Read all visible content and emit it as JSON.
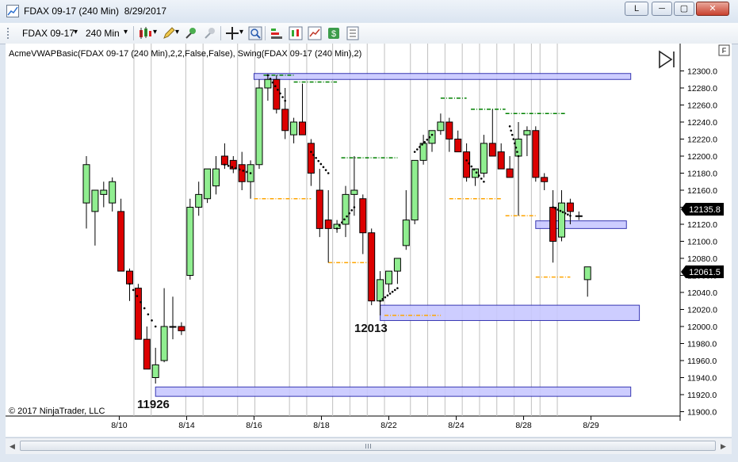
{
  "window": {
    "title": "FDAX 09-17 (240 Min)  8/29/2017",
    "btn_l": "L",
    "btn_min": "─",
    "btn_max": "▢",
    "btn_close": "✕"
  },
  "toolbar": {
    "instrument": "FDAX 09-17",
    "interval": "240 Min",
    "dropdown_glyph": "▾"
  },
  "chart": {
    "indicator_label": "AcmeVWAPBasic(FDAX 09-17 (240 Min),2,2,False,False), Swing(FDAX 09-17 (240 Min),2)",
    "copyright": "© 2017 NinjaTrader, LLC",
    "f_box": "F",
    "current_price_label": "12135.8",
    "secondary_price_label": "12061.5",
    "annotations": [
      "11926",
      "12013"
    ],
    "colors": {
      "up": "#90ee90",
      "down": "#dc0000",
      "zone": "#c8c8ff",
      "zone_border": "#2222aa",
      "swing_high": "#008000",
      "swing_low": "#ffa500"
    }
  },
  "chart_data": {
    "type": "candlestick",
    "instrument": "FDAX 09-17",
    "interval": "240 Min",
    "ylim": [
      11900,
      12310
    ],
    "y_ticks": [
      12300.0,
      12280.0,
      12260.0,
      12240.0,
      12220.0,
      12200.0,
      12180.0,
      12160.0,
      12140.0,
      12120.0,
      12100.0,
      12080.0,
      12060.0,
      12040.0,
      12020.0,
      12000.0,
      11980.0,
      11960.0,
      11940.0,
      11920.0,
      11900.0
    ],
    "x_tick_labels": [
      "8/10",
      "8/14",
      "8/16",
      "8/18",
      "8/22",
      "8/24",
      "8/28",
      "8/29"
    ],
    "x_tick_positions": [
      3.8,
      11.6,
      19.4,
      27.2,
      35.0,
      42.8,
      50.6,
      58.4
    ],
    "day_separators": [
      5.5,
      7.5,
      11.5,
      13.5,
      17.5,
      19.5,
      23.5,
      25.5,
      28.5,
      30.5,
      32.5,
      34.5,
      37.5,
      39.5,
      41.5,
      43.5,
      45.5,
      47.5,
      49.5,
      51.5,
      52.5,
      54.5
    ],
    "candles": [
      {
        "o": 12145,
        "h": 12200,
        "l": 12115,
        "c": 12190
      },
      {
        "o": 12135,
        "h": 12160,
        "l": 12095,
        "c": 12160
      },
      {
        "o": 12155,
        "h": 12170,
        "l": 12140,
        "c": 12160
      },
      {
        "o": 12145,
        "h": 12175,
        "l": 12135,
        "c": 12170
      },
      {
        "o": 12135,
        "h": 12150,
        "l": 12065,
        "c": 12065
      },
      {
        "o": 12065,
        "h": 12068,
        "l": 12030,
        "c": 12050
      },
      {
        "o": 12045,
        "h": 12050,
        "l": 11990,
        "c": 11985
      },
      {
        "o": 11985,
        "h": 12000,
        "l": 11960,
        "c": 11950
      },
      {
        "o": 11940,
        "h": 11975,
        "l": 11933,
        "c": 11955
      },
      {
        "o": 11960,
        "h": 12045,
        "l": 11958,
        "c": 12000
      },
      {
        "o": 12000,
        "h": 12035,
        "l": 11985,
        "c": 12000
      },
      {
        "o": 12000,
        "h": 12005,
        "l": 11990,
        "c": 11995
      },
      {
        "o": 12060,
        "h": 12150,
        "l": 12055,
        "c": 12140
      },
      {
        "o": 12140,
        "h": 12170,
        "l": 12130,
        "c": 12155
      },
      {
        "o": 12150,
        "h": 12185,
        "l": 12145,
        "c": 12185
      },
      {
        "o": 12165,
        "h": 12200,
        "l": 12155,
        "c": 12185
      },
      {
        "o": 12200,
        "h": 12215,
        "l": 12185,
        "c": 12190
      },
      {
        "o": 12195,
        "h": 12200,
        "l": 12180,
        "c": 12185
      },
      {
        "o": 12190,
        "h": 12205,
        "l": 12160,
        "c": 12170
      },
      {
        "o": 12170,
        "h": 12195,
        "l": 12150,
        "c": 12190
      },
      {
        "o": 12190,
        "h": 12290,
        "l": 12185,
        "c": 12280
      },
      {
        "o": 12280,
        "h": 12295,
        "l": 12265,
        "c": 12290
      },
      {
        "o": 12290,
        "h": 12295,
        "l": 12250,
        "c": 12255
      },
      {
        "o": 12255,
        "h": 12280,
        "l": 12220,
        "c": 12230
      },
      {
        "o": 12225,
        "h": 12245,
        "l": 12215,
        "c": 12240
      },
      {
        "o": 12240,
        "h": 12285,
        "l": 12225,
        "c": 12225
      },
      {
        "o": 12215,
        "h": 12220,
        "l": 12165,
        "c": 12180
      },
      {
        "o": 12160,
        "h": 12185,
        "l": 12105,
        "c": 12115
      },
      {
        "o": 12125,
        "h": 12160,
        "l": 12075,
        "c": 12115
      },
      {
        "o": 12115,
        "h": 12125,
        "l": 12110,
        "c": 12120
      },
      {
        "o": 12120,
        "h": 12165,
        "l": 12105,
        "c": 12155
      },
      {
        "o": 12155,
        "h": 12200,
        "l": 12130,
        "c": 12160
      },
      {
        "o": 12150,
        "h": 12155,
        "l": 12085,
        "c": 12110
      },
      {
        "o": 12110,
        "h": 12115,
        "l": 12025,
        "c": 12030
      },
      {
        "o": 12030,
        "h": 12065,
        "l": 12013,
        "c": 12055
      },
      {
        "o": 12050,
        "h": 12060,
        "l": 12040,
        "c": 12065
      },
      {
        "o": 12065,
        "h": 12080,
        "l": 12050,
        "c": 12080
      },
      {
        "o": 12095,
        "h": 12160,
        "l": 12090,
        "c": 12125
      },
      {
        "o": 12125,
        "h": 12185,
        "l": 12120,
        "c": 12195
      },
      {
        "o": 12195,
        "h": 12225,
        "l": 12190,
        "c": 12215
      },
      {
        "o": 12215,
        "h": 12230,
        "l": 12205,
        "c": 12230
      },
      {
        "o": 12230,
        "h": 12250,
        "l": 12225,
        "c": 12240
      },
      {
        "o": 12240,
        "h": 12245,
        "l": 12205,
        "c": 12220
      },
      {
        "o": 12220,
        "h": 12230,
        "l": 12205,
        "c": 12205
      },
      {
        "o": 12205,
        "h": 12215,
        "l": 12170,
        "c": 12175
      },
      {
        "o": 12175,
        "h": 12185,
        "l": 12165,
        "c": 12185
      },
      {
        "o": 12180,
        "h": 12225,
        "l": 12175,
        "c": 12215
      },
      {
        "o": 12215,
        "h": 12255,
        "l": 12200,
        "c": 12200
      },
      {
        "o": 12205,
        "h": 12215,
        "l": 12185,
        "c": 12185
      },
      {
        "o": 12185,
        "h": 12200,
        "l": 12175,
        "c": 12175
      },
      {
        "o": 12200,
        "h": 12240,
        "l": 12130,
        "c": 12220
      },
      {
        "o": 12225,
        "h": 12235,
        "l": 12200,
        "c": 12230
      },
      {
        "o": 12230,
        "h": 12235,
        "l": 12170,
        "c": 12175
      },
      {
        "o": 12175,
        "h": 12180,
        "l": 12160,
        "c": 12170
      },
      {
        "o": 12140,
        "h": 12160,
        "l": 12075,
        "c": 12100
      },
      {
        "o": 12105,
        "h": 12160,
        "l": 12100,
        "c": 12145
      },
      {
        "o": 12145,
        "h": 12150,
        "l": 12120,
        "c": 12135
      },
      {
        "o": 12130,
        "h": 12135,
        "l": 12125,
        "c": 12130
      },
      {
        "o": 12055,
        "h": 12070,
        "l": 12035,
        "c": 12070
      }
    ],
    "zones": [
      {
        "x0": 19.4,
        "x1": 63.0,
        "y0": 12297,
        "y1": 12290
      },
      {
        "x0": 8.0,
        "x1": 63.0,
        "y0": 11929,
        "y1": 11918
      },
      {
        "x0": 34.0,
        "x1": 64.0,
        "y0": 12025,
        "y1": 12007
      },
      {
        "x0": 52.0,
        "x1": 62.5,
        "y0": 12124,
        "y1": 12115
      }
    ],
    "swing_highs": [
      {
        "x0": 20.5,
        "x1": 24.0,
        "y": 12295
      },
      {
        "x0": 24.0,
        "x1": 29.0,
        "y": 12287
      },
      {
        "x0": 29.5,
        "x1": 36.0,
        "y": 12198
      },
      {
        "x0": 41.0,
        "x1": 44.0,
        "y": 12268
      },
      {
        "x0": 44.5,
        "x1": 48.5,
        "y": 12255
      },
      {
        "x0": 48.5,
        "x1": 55.5,
        "y": 12250
      }
    ],
    "swing_lows": [
      {
        "x0": 19.4,
        "x1": 26.0,
        "y": 12150
      },
      {
        "x0": 28.0,
        "x1": 33.0,
        "y": 12075
      },
      {
        "x0": 34.5,
        "x1": 41.0,
        "y": 12013
      },
      {
        "x0": 42.0,
        "x1": 48.0,
        "y": 12150
      },
      {
        "x0": 48.5,
        "x1": 52.0,
        "y": 12130
      },
      {
        "x0": 52.0,
        "x1": 56.0,
        "y": 12058
      }
    ],
    "vwap_dots": [
      {
        "x0": 5,
        "x1": 8,
        "y0": 12050,
        "y1": 12000
      },
      {
        "x0": 16,
        "x1": 19,
        "y0": 12190,
        "y1": 12180
      },
      {
        "x0": 21,
        "x1": 23,
        "y0": 12295,
        "y1": 12265
      },
      {
        "x0": 26,
        "x1": 28,
        "y0": 12205,
        "y1": 12180
      },
      {
        "x0": 29,
        "x1": 31,
        "y0": 12115,
        "y1": 12140
      },
      {
        "x0": 34,
        "x1": 36,
        "y0": 12030,
        "y1": 12045
      },
      {
        "x0": 38,
        "x1": 40,
        "y0": 12205,
        "y1": 12225
      },
      {
        "x0": 44,
        "x1": 46,
        "y0": 12195,
        "y1": 12170
      },
      {
        "x0": 49,
        "x1": 50,
        "y0": 12235,
        "y1": 12200
      },
      {
        "x0": 54,
        "x1": 56,
        "y0": 12140,
        "y1": 12130
      }
    ]
  }
}
